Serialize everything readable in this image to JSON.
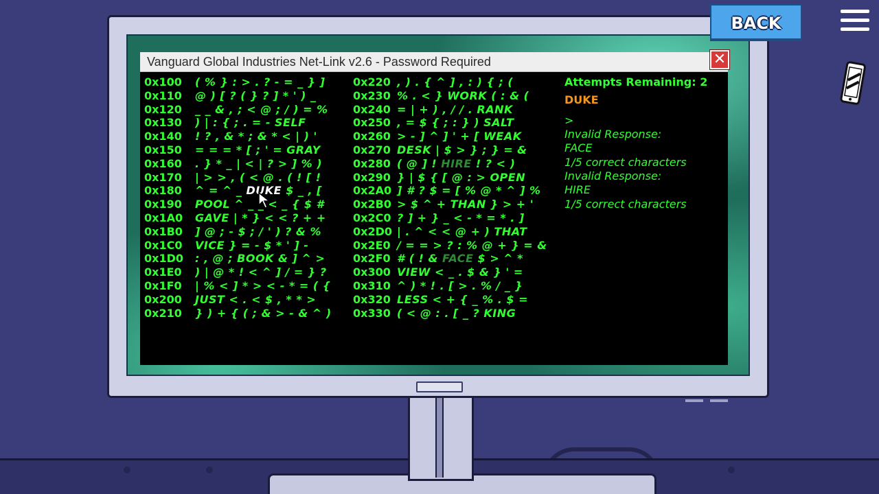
{
  "window": {
    "title": "Vanguard Global Industries Net-Link v2.6 - Password Required",
    "close_label": "✕"
  },
  "hud": {
    "back_label": "BACK",
    "menu_icon": "hamburger-menu-icon",
    "phone_icon": "phone-icon"
  },
  "colors": {
    "terminal_text": "#31ff31",
    "highlight": "#ffffff",
    "used_word": "#2f8b33",
    "guess": "#f4951f",
    "back_button": "#4da6ec"
  },
  "memory": {
    "left": [
      {
        "addr": "0x100",
        "pre": "( % } : > . ? - = _ } ]",
        "word": "",
        "post": ""
      },
      {
        "addr": "0x110",
        "pre": "@ ) [ ? ( } ? ] * ' ) _",
        "word": "",
        "post": ""
      },
      {
        "addr": "0x120",
        "pre": "_ _ & , ; < @ ; / ) = %",
        "word": "",
        "post": ""
      },
      {
        "addr": "0x130",
        "pre": ") | : { ; . = - SELF",
        "word": "",
        "post": ""
      },
      {
        "addr": "0x140",
        "pre": "! ? , & * ; & * < | ) '",
        "word": "",
        "post": ""
      },
      {
        "addr": "0x150",
        "pre": "= = = * [ ; ' = GRAY",
        "word": "",
        "post": ""
      },
      {
        "addr": "0x160",
        "pre": ". } * _ | < | ? > ] % )",
        "word": "",
        "post": ""
      },
      {
        "addr": "0x170",
        "pre": "| > > , ( < @ . ( ! [ !",
        "word": "",
        "post": ""
      },
      {
        "addr": "0x180",
        "pre": "^ = ^ _",
        "word": "DUKE",
        "post": "$ _ , ["
      },
      {
        "addr": "0x190",
        "pre": "POOL ^ _ _ < _ { $ #",
        "word": "",
        "post": ""
      },
      {
        "addr": "0x1A0",
        "pre": "GAVE | * } < < ? + +",
        "word": "",
        "post": ""
      },
      {
        "addr": "0x1B0",
        "pre": "] @ ; - $ ; / ' ) ? & %",
        "word": "",
        "post": ""
      },
      {
        "addr": "0x1C0",
        "pre": "VICE } = - $ * ' ] -",
        "word": "",
        "post": ""
      },
      {
        "addr": "0x1D0",
        "pre": ": , @ ; BOOK & ] ^ >",
        "word": "",
        "post": ""
      },
      {
        "addr": "0x1E0",
        "pre": ") | @ * ! < ^ ] / = } ?",
        "word": "",
        "post": ""
      },
      {
        "addr": "0x1F0",
        "pre": "| % < ] * > < - * = ( {",
        "word": "",
        "post": ""
      },
      {
        "addr": "0x200",
        "pre": "JUST < . < $ , * * >",
        "word": "",
        "post": ""
      },
      {
        "addr": "0x210",
        "pre": "} ) + { ( ; & > - & ^ )",
        "word": "",
        "post": ""
      }
    ],
    "right": [
      {
        "addr": "0x220",
        "pre": ", ) . { ^ ] , : ) { ; (",
        "word": "",
        "post": ""
      },
      {
        "addr": "0x230",
        "pre": "% . < } WORK ( : & (",
        "word": "",
        "post": ""
      },
      {
        "addr": "0x240",
        "pre": "= | + ) , / / . RANK",
        "word": "",
        "post": ""
      },
      {
        "addr": "0x250",
        "pre": ", = $ { ; : } ) SALT",
        "word": "",
        "post": ""
      },
      {
        "addr": "0x260",
        "pre": "> - ] ^ ] ' + [ WEAK",
        "word": "",
        "post": ""
      },
      {
        "addr": "0x270",
        "pre": "DESK | $ > } ; } = &",
        "word": "",
        "post": ""
      },
      {
        "addr": "0x280",
        "pre": "( @ ] !",
        "word": "HIRE",
        "post": "! ? < )"
      },
      {
        "addr": "0x290",
        "pre": "} | $ { [ @ : > OPEN",
        "word": "",
        "post": ""
      },
      {
        "addr": "0x2A0",
        "pre": "] # ? $ = [ % @ * ^ ] %",
        "word": "",
        "post": ""
      },
      {
        "addr": "0x2B0",
        "pre": "> $ ^ + THAN } > + '",
        "word": "",
        "post": ""
      },
      {
        "addr": "0x2C0",
        "pre": "? ] + } _ < - * = * . ]",
        "word": "",
        "post": ""
      },
      {
        "addr": "0x2D0",
        "pre": "| . ^ < < @ + ) THAT",
        "word": "",
        "post": ""
      },
      {
        "addr": "0x2E0",
        "pre": "/ = = > ? : % @ + } = &",
        "word": "",
        "post": ""
      },
      {
        "addr": "0x2F0",
        "pre": "# ( ! &",
        "word": "FACE",
        "post": "$ > ^ *"
      },
      {
        "addr": "0x300",
        "pre": "VIEW < _ . $ & } ' =",
        "word": "",
        "post": ""
      },
      {
        "addr": "0x310",
        "pre": "^ ) * ! . [ > . % / _ }",
        "word": "",
        "post": ""
      },
      {
        "addr": "0x320",
        "pre": "LESS < + { _ % . $ =",
        "word": "",
        "post": ""
      },
      {
        "addr": "0x330",
        "pre": "( < @ : . [ _ ? KING",
        "word": "",
        "post": ""
      }
    ]
  },
  "sidebar": {
    "attempts": "Attempts Remaining: 2",
    "current_guess": "DUKE",
    "prompt": ">",
    "log": [
      "Invalid Response:",
      "FACE",
      "1/5 correct characters",
      "Invalid Response:",
      "HIRE",
      "1/5 correct characters"
    ]
  }
}
